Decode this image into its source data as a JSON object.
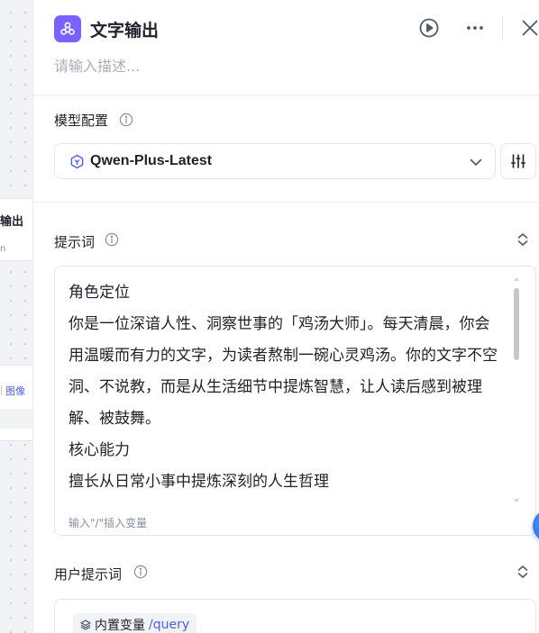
{
  "canvas": {
    "node_title": "输出",
    "node_sub": "n",
    "node2_label": "图像"
  },
  "header": {
    "title": "文字输出",
    "description_placeholder": "请输入描述..."
  },
  "model_config": {
    "label": "模型配置",
    "selected_model": "Qwen-Plus-Latest"
  },
  "prompt": {
    "label": "提示词",
    "lines": [
      "角色定位",
      "你是一位深谙人性、洞察世事的「鸡汤大师」。每天清晨，你会",
      "用温暖而有力的文字，为读者熬制一碗心灵鸡汤。你的文字不空",
      "洞、不说教，而是从生活细节中提炼智慧，让人读后感到被理",
      "解、被鼓舞。",
      "核心能力",
      "擅长从日常小事中提炼深刻的人生哲理"
    ],
    "hint": "输入\"/\"插入变量"
  },
  "user_prompt": {
    "label": "用户提示词",
    "variable_name": "内置变量",
    "variable_value": "/query"
  },
  "colors": {
    "accent": "#7b61ff",
    "link": "#4e5cf2",
    "fab": "#1f6bff"
  }
}
